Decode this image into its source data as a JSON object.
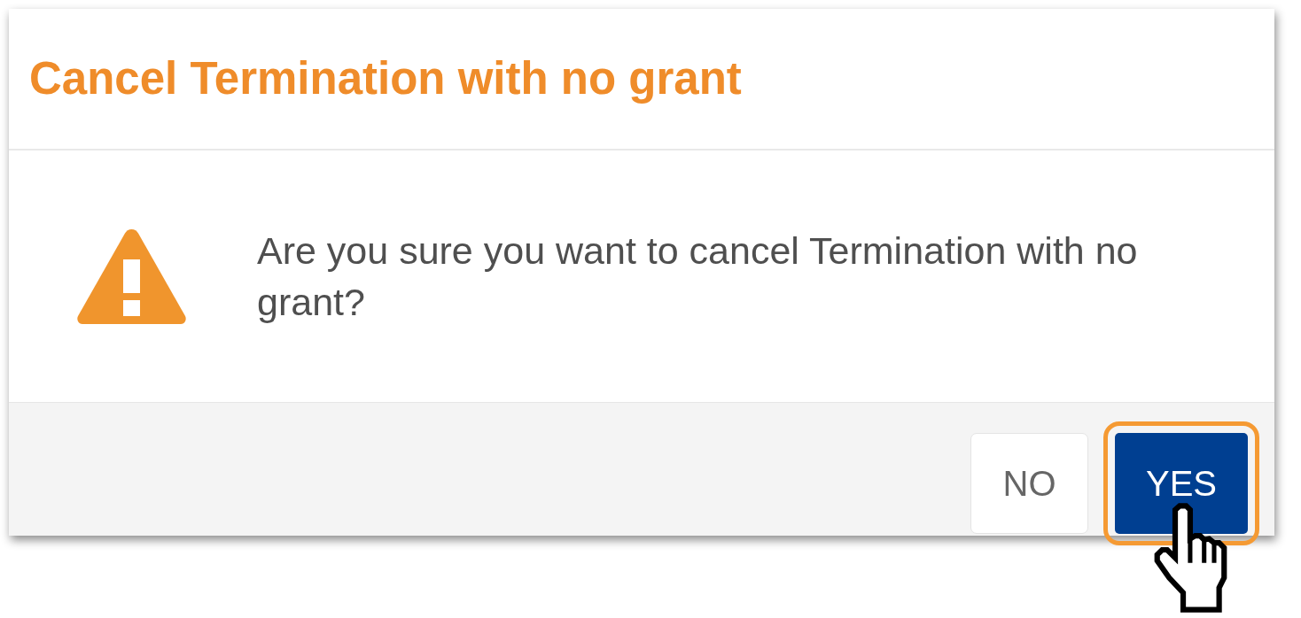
{
  "dialog": {
    "title": "Cancel Termination with no grant",
    "message": "Are you sure you want to cancel Termination with no grant?",
    "buttons": [
      {
        "label": "NO",
        "kind": "secondary",
        "focused": false
      },
      {
        "label": "YES",
        "kind": "primary",
        "focused": true
      }
    ]
  }
}
